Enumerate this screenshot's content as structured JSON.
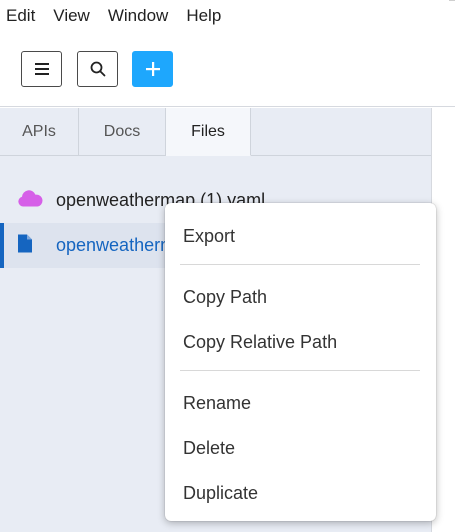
{
  "menubar": {
    "items": [
      "Edit",
      "View",
      "Window",
      "Help"
    ]
  },
  "toolbar": {
    "buttons": [
      {
        "name": "menu",
        "icon": "hamburger-icon"
      },
      {
        "name": "search",
        "icon": "search-icon"
      },
      {
        "name": "add",
        "icon": "plus-icon",
        "color": "#1ea7fd"
      }
    ]
  },
  "sidebar": {
    "tabs": [
      "APIs",
      "Docs",
      "Files"
    ],
    "active_tab": "Files",
    "files": [
      {
        "name": "openweathermap (1).yaml",
        "icon": "cloud-icon",
        "icon_color": "#d65fe8"
      },
      {
        "name": "openweathermap.yaml",
        "icon": "file-icon",
        "icon_color": "#1565c0"
      }
    ]
  },
  "context_menu": {
    "items": [
      "Export",
      "Copy Path",
      "Copy Relative Path",
      "Rename",
      "Delete",
      "Duplicate"
    ]
  }
}
